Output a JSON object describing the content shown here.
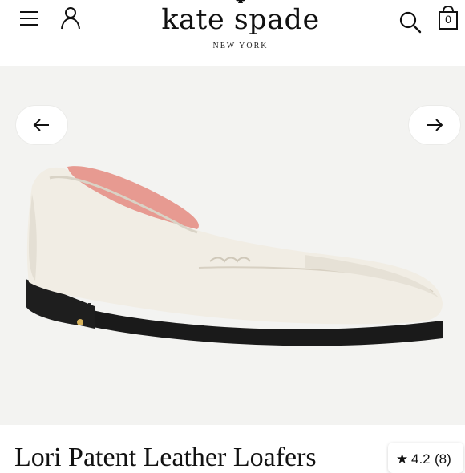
{
  "header": {
    "brand_name": "kate spade",
    "brand_sub": "NEW YORK",
    "bag_count": "0",
    "icons": [
      "menu-icon",
      "account-icon",
      "search-icon",
      "shopping-bag-icon"
    ]
  },
  "gallery": {
    "prev_icon": "arrow-left-icon",
    "next_icon": "arrow-right-icon",
    "image": "cream patent leather loafer"
  },
  "product": {
    "title": "Lori Patent Leather Loafers",
    "rating": {
      "star": "★",
      "value": "4.2",
      "count": "(8)"
    }
  },
  "colors": {
    "text": "#111111",
    "gallery_bg": "#f3f3f1",
    "lining_pink": "#e79a91",
    "sole_black": "#1a1a1a",
    "shoe_cream": "#f1ede4"
  }
}
